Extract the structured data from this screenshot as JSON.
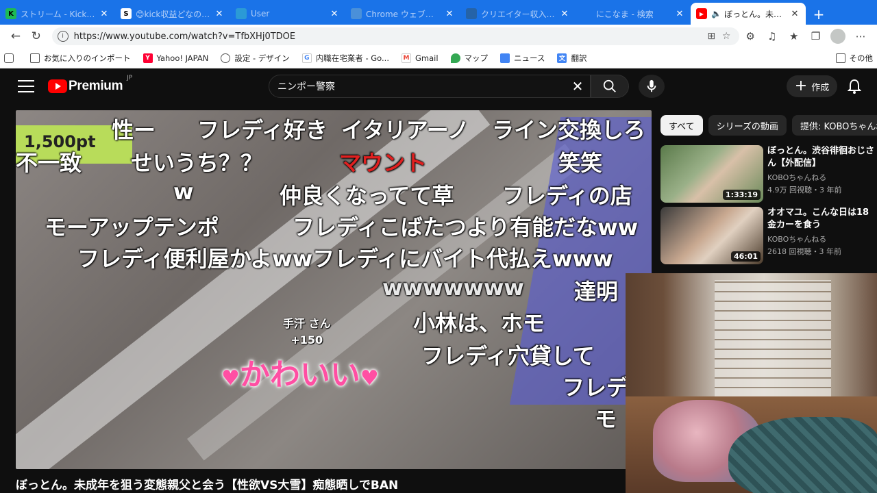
{
  "browser": {
    "tabs": [
      {
        "title": "ストリーム - Kick Dashboard",
        "favicon_color": "#1db954",
        "glyph": "K"
      },
      {
        "title": "😊kick収益どなの？😊A",
        "favicon_color": "#ffffff",
        "glyph": "S"
      },
      {
        "title": "User",
        "favicon_color": "#2b9ad6",
        "glyph": ""
      },
      {
        "title": "Chrome ウェブストア - 拡張",
        "favicon_color": "#4a90d9",
        "glyph": ""
      },
      {
        "title": "クリエイター収入窓口",
        "favicon_color": "#2563a8",
        "glyph": ""
      },
      {
        "title": "にこなま - 検索",
        "favicon_color": "#1a73e8",
        "glyph": ""
      },
      {
        "title": "ぼっとん。未成年を狙う",
        "favicon_color": "#ff0000",
        "glyph": "▶",
        "active": true
      }
    ],
    "url": "https://www.youtube.com/watch?v=TfbXHj0TDOE",
    "bookmarks": [
      {
        "label": "お気に入りのインポート",
        "color": "#555555"
      },
      {
        "label": "Yahoo! JAPAN",
        "color": "#ff0033",
        "glyph": "Y!"
      },
      {
        "label": "設定 - デザイン",
        "color": "#555555"
      },
      {
        "label": "内職在宅業者 - Go...",
        "color": "#4285f4",
        "glyph": "G"
      },
      {
        "label": "Gmail",
        "color": "#ea4335",
        "glyph": "M"
      },
      {
        "label": "マップ",
        "color": "#34a853"
      },
      {
        "label": "ニュース",
        "color": "#4285f4"
      },
      {
        "label": "翻訳",
        "color": "#4285f4"
      }
    ],
    "bookmarks_other": "その他"
  },
  "youtube": {
    "logo_text": "Premium",
    "logo_region": "JP",
    "search_query": "ニンポー警察",
    "create_label": "作成",
    "video_title": "ぼっとん。未成年を狙う変態親父と会う【性欲VS大雪】痴態晒しでBAN",
    "chips": [
      "すべて",
      "シリーズの動画",
      "提供: KOBOちゃんね"
    ],
    "recommendations": [
      {
        "title": "ぼっとん。渋谷徘徊おじさん【外配信】",
        "channel": "KOBOちゃんねる",
        "stats": "4.9万 回視聴・3 年前",
        "duration": "1:33:19"
      },
      {
        "title": "オオマユ。こんな日は18金カーを食う",
        "channel": "KOBOちゃんねる",
        "stats": "2618 回視聴・3 年前",
        "duration": "46:01"
      }
    ]
  },
  "overlay": {
    "points": "1,500pt",
    "comments": [
      {
        "text": "性ー",
        "color": "white"
      },
      {
        "text": "フレディ好き",
        "color": "white"
      },
      {
        "text": "イタリアーノ",
        "color": "white"
      },
      {
        "text": "ライン交換しろ",
        "color": "white"
      },
      {
        "text": "不一致",
        "color": "white"
      },
      {
        "text": "せいうち？？",
        "color": "white"
      },
      {
        "text": "マウント",
        "color": "red"
      },
      {
        "text": "笑笑",
        "color": "white"
      },
      {
        "text": "w",
        "color": "white"
      },
      {
        "text": "仲良くなってて草",
        "color": "white"
      },
      {
        "text": "フレディの店",
        "color": "white"
      },
      {
        "text": "モーアップテンポ",
        "color": "white"
      },
      {
        "text": "フレディこばたつより有能だなww",
        "color": "white"
      },
      {
        "text": "フレディ便利屋かよwwフレディにバイト代払えwww",
        "color": "white"
      },
      {
        "text": "wwwwwww",
        "color": "white"
      },
      {
        "text": "達明",
        "color": "white"
      },
      {
        "text": "小林は、ホモ",
        "color": "white"
      },
      {
        "text": "フレディ穴貸して",
        "color": "white"
      },
      {
        "text": "フレデ",
        "color": "white"
      },
      {
        "text": "モ",
        "color": "white"
      }
    ],
    "gift_user": "手汗 さん",
    "gift_amount": "+150",
    "sticker_text": "かわいい"
  }
}
